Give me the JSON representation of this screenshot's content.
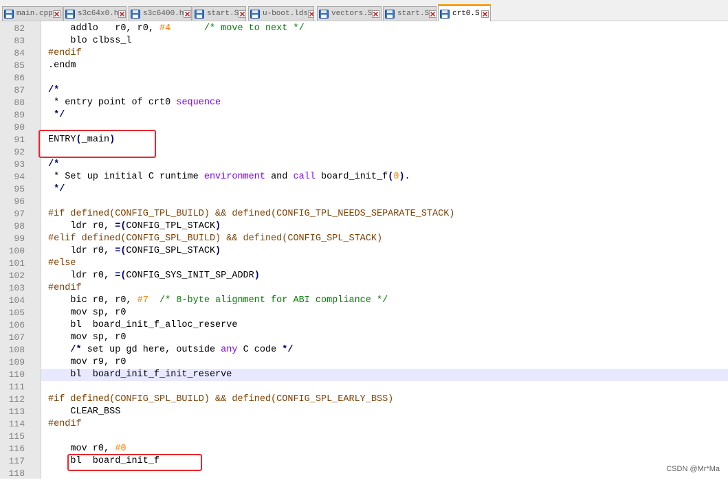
{
  "tabs": [
    {
      "label": "main.cpp",
      "active": false
    },
    {
      "label": "s3c64x0.h",
      "active": false
    },
    {
      "label": "s3c6400.h",
      "active": false
    },
    {
      "label": "start.S",
      "active": false
    },
    {
      "label": "u-boot.lds",
      "active": false
    },
    {
      "label": "vectors.S",
      "active": false
    },
    {
      "label": "start.S",
      "active": false
    },
    {
      "label": "crt0.S",
      "active": true
    }
  ],
  "editor": {
    "current_line": 110,
    "lines": [
      {
        "n": "82",
        "tokens": [
          [
            "    addlo   r0, r0, ",
            ""
          ],
          [
            "#4",
            "num"
          ],
          [
            "      ",
            ""
          ],
          [
            "/* move to next */",
            "cmt"
          ]
        ]
      },
      {
        "n": "83",
        "tokens": [
          [
            "    blo clbss_l",
            ""
          ]
        ]
      },
      {
        "n": "84",
        "tokens": [
          [
            "#endif",
            "pre"
          ]
        ]
      },
      {
        "n": "85",
        "tokens": [
          [
            ".endm",
            ""
          ]
        ]
      },
      {
        "n": "86",
        "tokens": []
      },
      {
        "n": "87",
        "tokens": [
          [
            "/*",
            "op"
          ]
        ]
      },
      {
        "n": "88",
        "tokens": [
          [
            " * entry point of crt0 ",
            ""
          ],
          [
            "sequence",
            "kw"
          ]
        ]
      },
      {
        "n": "89",
        "tokens": [
          [
            " */",
            "op"
          ]
        ]
      },
      {
        "n": "90",
        "tokens": []
      },
      {
        "n": "91",
        "tokens": [
          [
            "ENTRY",
            ""
          ],
          [
            "(",
            "op"
          ],
          [
            "_main",
            ""
          ],
          [
            ")",
            "op"
          ]
        ]
      },
      {
        "n": "92",
        "tokens": []
      },
      {
        "n": "93",
        "tokens": [
          [
            "/*",
            "op"
          ]
        ]
      },
      {
        "n": "94",
        "tokens": [
          [
            " * Set up initial C runtime ",
            ""
          ],
          [
            "environment",
            "kw"
          ],
          [
            " and ",
            ""
          ],
          [
            "call",
            "kw"
          ],
          [
            " board_init_f",
            ""
          ],
          [
            "(",
            "op"
          ],
          [
            "0",
            "num"
          ],
          [
            ")",
            "op"
          ],
          [
            ".",
            ""
          ]
        ]
      },
      {
        "n": "95",
        "tokens": [
          [
            " */",
            "op"
          ]
        ]
      },
      {
        "n": "96",
        "tokens": []
      },
      {
        "n": "97",
        "tokens": [
          [
            "#if defined(CONFIG_TPL_BUILD) && defined(CONFIG_TPL_NEEDS_SEPARATE_STACK)",
            "pre"
          ]
        ]
      },
      {
        "n": "98",
        "tokens": [
          [
            "    ldr r0, ",
            ""
          ],
          [
            "=(",
            "op"
          ],
          [
            "CONFIG_TPL_STACK",
            ""
          ],
          [
            ")",
            "op"
          ]
        ]
      },
      {
        "n": "99",
        "tokens": [
          [
            "#elif defined(CONFIG_SPL_BUILD) && defined(CONFIG_SPL_STACK)",
            "pre"
          ]
        ]
      },
      {
        "n": "100",
        "tokens": [
          [
            "    ldr r0, ",
            ""
          ],
          [
            "=(",
            "op"
          ],
          [
            "CONFIG_SPL_STACK",
            ""
          ],
          [
            ")",
            "op"
          ]
        ]
      },
      {
        "n": "101",
        "tokens": [
          [
            "#else",
            "pre"
          ]
        ]
      },
      {
        "n": "102",
        "tokens": [
          [
            "    ldr r0, ",
            ""
          ],
          [
            "=(",
            "op"
          ],
          [
            "CONFIG_SYS_INIT_SP_ADDR",
            ""
          ],
          [
            ")",
            "op"
          ]
        ]
      },
      {
        "n": "103",
        "tokens": [
          [
            "#endif",
            "pre"
          ]
        ]
      },
      {
        "n": "104",
        "tokens": [
          [
            "    bic r0, r0, ",
            ""
          ],
          [
            "#7",
            "num"
          ],
          [
            "  ",
            ""
          ],
          [
            "/* 8-byte alignment for ABI compliance */",
            "cmt"
          ]
        ]
      },
      {
        "n": "105",
        "tokens": [
          [
            "    mov sp, r0",
            ""
          ]
        ]
      },
      {
        "n": "106",
        "tokens": [
          [
            "    bl  board_init_f_alloc_reserve",
            ""
          ]
        ]
      },
      {
        "n": "107",
        "tokens": [
          [
            "    mov sp, r0",
            ""
          ]
        ]
      },
      {
        "n": "108",
        "tokens": [
          [
            "    ",
            ""
          ],
          [
            "/*",
            "op"
          ],
          [
            " set up gd here, outside ",
            ""
          ],
          [
            "any",
            "kw"
          ],
          [
            " C code ",
            ""
          ],
          [
            "*/",
            "op"
          ]
        ]
      },
      {
        "n": "109",
        "tokens": [
          [
            "    mov r9, r0",
            ""
          ]
        ]
      },
      {
        "n": "110",
        "tokens": [
          [
            "    bl  board_init_f_init_reserve",
            ""
          ]
        ]
      },
      {
        "n": "111",
        "tokens": []
      },
      {
        "n": "112",
        "tokens": [
          [
            "#if defined(CONFIG_SPL_BUILD) && defined(CONFIG_SPL_EARLY_BSS)",
            "pre"
          ]
        ]
      },
      {
        "n": "113",
        "tokens": [
          [
            "    CLEAR_BSS",
            ""
          ]
        ]
      },
      {
        "n": "114",
        "tokens": [
          [
            "#endif",
            "pre"
          ]
        ]
      },
      {
        "n": "115",
        "tokens": []
      },
      {
        "n": "116",
        "tokens": [
          [
            "    mov r0, ",
            ""
          ],
          [
            "#0",
            "num"
          ]
        ]
      },
      {
        "n": "117",
        "tokens": [
          [
            "    bl  board_init_f",
            ""
          ]
        ]
      },
      {
        "n": "118",
        "tokens": []
      }
    ]
  },
  "watermark": "CSDN @Mr*Ma",
  "colors": {
    "comment": "#008000",
    "preprocessor": "#804000",
    "keyword": "#8000ff",
    "number": "#ff8000",
    "operator": "#000080",
    "current_line": "#e8e8ff",
    "annotation_box": "#e8282d",
    "active_tab_accent": "#f9a21b"
  }
}
